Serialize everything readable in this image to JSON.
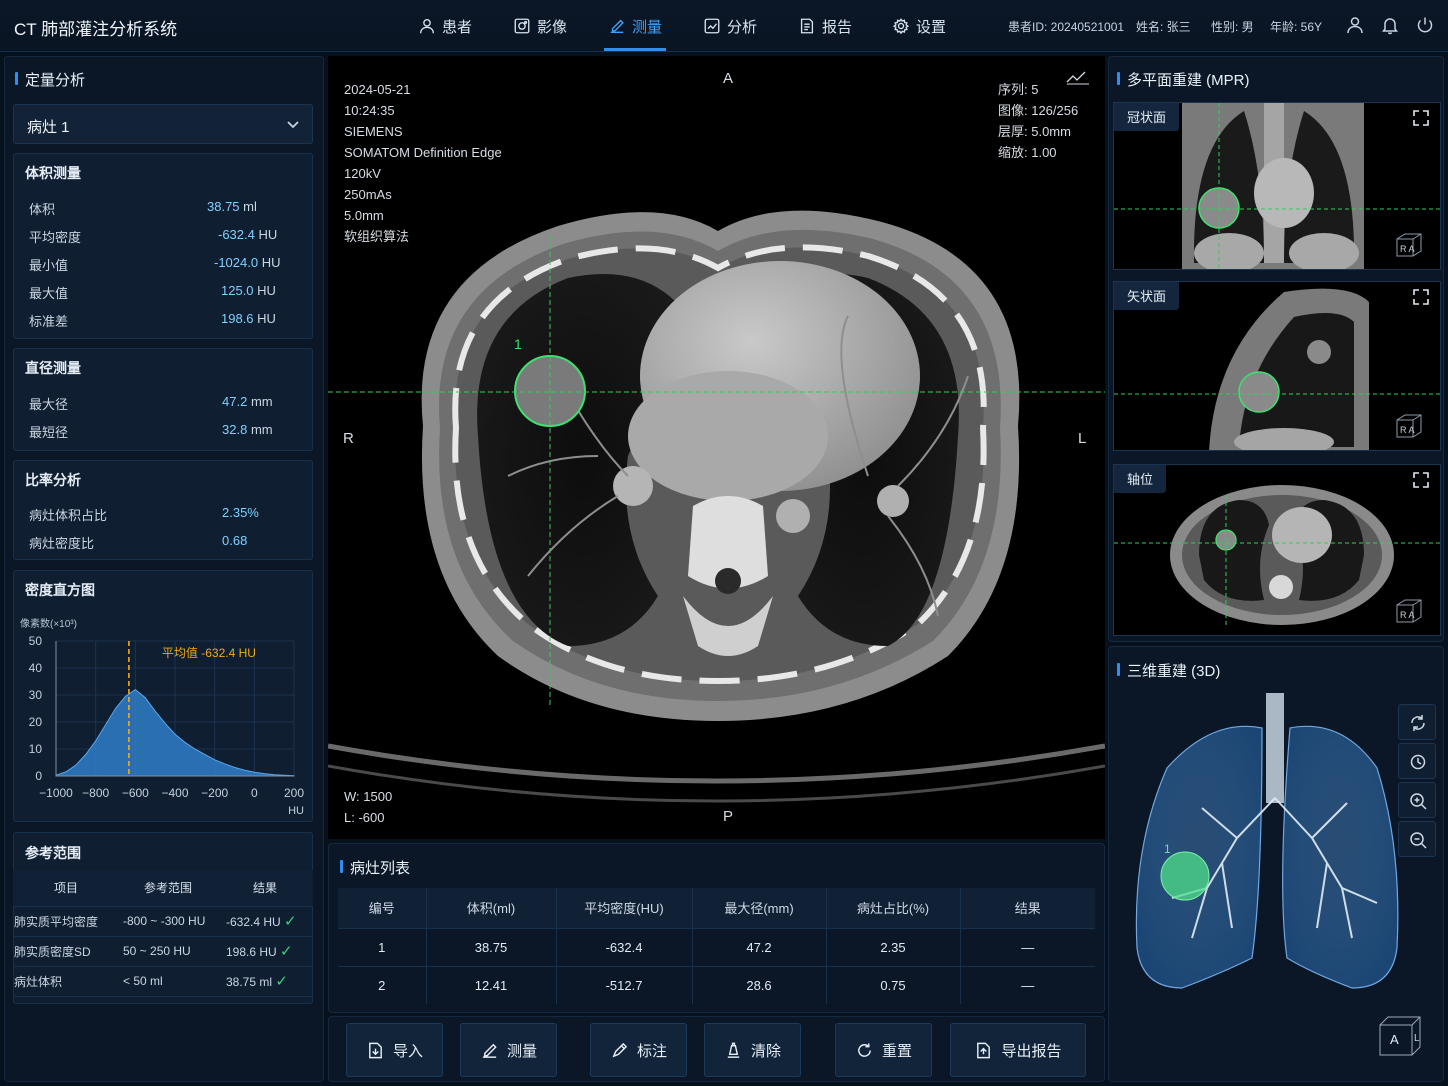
{
  "app": {
    "title": "CT 肺部灌注分析系统"
  },
  "nav": [
    {
      "label": "患者",
      "icon": "user-icon"
    },
    {
      "label": "影像",
      "icon": "image-icon"
    },
    {
      "label": "测量",
      "icon": "edit-icon",
      "active": true
    },
    {
      "label": "分析",
      "icon": "chart-icon"
    },
    {
      "label": "报告",
      "icon": "report-icon"
    },
    {
      "label": "设置",
      "icon": "gear-icon"
    }
  ],
  "patient": {
    "id": "患者ID: 20240521001",
    "name": "姓名: 张三",
    "sex": "性别: 男",
    "age": "年龄: 56Y"
  },
  "left": {
    "title": "定量分析",
    "lesion_select": "病灶 1",
    "volume": {
      "title": "体积测量",
      "rows": [
        {
          "k": "体积",
          "v": "38.75",
          "u": "ml"
        },
        {
          "k": "平均密度",
          "v": "-632.4",
          "u": "HU"
        },
        {
          "k": "最小值",
          "v": "-1024.0",
          "u": "HU"
        },
        {
          "k": "最大值",
          "v": "125.0",
          "u": "HU"
        },
        {
          "k": "标准差",
          "v": "198.6",
          "u": "HU"
        }
      ]
    },
    "diameter": {
      "title": "直径测量",
      "rows": [
        {
          "k": "最大径",
          "v": "47.2",
          "u": "mm"
        },
        {
          "k": "最短径",
          "v": "32.8",
          "u": "mm"
        }
      ]
    },
    "ratio": {
      "title": "比率分析",
      "rows": [
        {
          "k": "病灶体积占比",
          "v": "2.35%",
          "u": ""
        },
        {
          "k": "病灶密度比",
          "v": "0.68",
          "u": ""
        }
      ]
    },
    "histogram": {
      "title": "密度直方图",
      "ylabel": "像素数(×10³)",
      "xunit": "HU",
      "mean_label": "平均值 -632.4 HU"
    },
    "reference": {
      "title": "参考范围",
      "headers": [
        "项目",
        "参考范围",
        "结果"
      ],
      "rows": [
        {
          "item": "肺实质平均密度",
          "range": "-800 ~ -300 HU",
          "result": "-632.4 HU",
          "ok": "✓"
        },
        {
          "item": "肺实质密度SD",
          "range": "50 ~ 250 HU",
          "result": "198.6 HU",
          "ok": "✓"
        },
        {
          "item": "病灶体积",
          "range": "< 50 ml",
          "result": "38.75 ml",
          "ok": "✓"
        }
      ]
    }
  },
  "chart_data": {
    "type": "area",
    "ylabel": "像素数(×10³)",
    "xlabel": "HU",
    "xlim": [
      -1000,
      200
    ],
    "ylim": [
      0,
      50
    ],
    "x_ticks": [
      "-1000",
      "-800",
      "-600",
      "-400",
      "-200",
      "0",
      "200"
    ],
    "y_ticks": [
      "0",
      "10",
      "20",
      "30",
      "40",
      "50"
    ],
    "x": [
      -1000,
      -950,
      -900,
      -850,
      -800,
      -750,
      -700,
      -650,
      -600,
      -550,
      -500,
      -450,
      -400,
      -350,
      -300,
      -250,
      -200,
      -150,
      -100,
      -50,
      0,
      50,
      100,
      150,
      200
    ],
    "values": [
      0.3,
      1.5,
      4,
      8,
      13,
      19,
      25,
      29.5,
      32,
      29,
      24,
      19.5,
      15.5,
      12.5,
      10,
      8,
      6,
      4.5,
      3.2,
      2.2,
      1.4,
      0.9,
      0.5,
      0.3,
      0.1
    ],
    "mean_marker": {
      "x": -632.4,
      "label": "平均值 -632.4 HU"
    },
    "grid": true
  },
  "viewer": {
    "info_left": [
      "2024-05-21",
      "10:24:35",
      "SIEMENS",
      "SOMATOM Definition Edge",
      "120kV",
      "250mAs",
      "5.0mm",
      "软组织算法"
    ],
    "info_right": [
      "序列: 5",
      "图像: 126/256",
      "层厚: 5.0mm",
      "缩放: 1.00"
    ],
    "orient": {
      "top": "A",
      "bottom": "P",
      "left": "R",
      "right": "L"
    },
    "window": [
      "W: 1500",
      "L: -600"
    ],
    "lesion_marker": "1"
  },
  "lesion_list": {
    "title": "病灶列表",
    "headers": [
      "编号",
      "体积(ml)",
      "平均密度(HU)",
      "最大径(mm)",
      "病灶占比(%)",
      "结果"
    ],
    "rows": [
      [
        "1",
        "38.75",
        "-632.4",
        "47.2",
        "2.35",
        "—"
      ],
      [
        "2",
        "12.41",
        "-512.7",
        "28.6",
        "0.75",
        "—"
      ]
    ]
  },
  "toolbar": [
    {
      "label": "导入",
      "icon": "import-icon"
    },
    {
      "label": "测量",
      "icon": "measure-icon"
    },
    {
      "label": "标注",
      "icon": "annotate-icon"
    },
    {
      "label": "清除",
      "icon": "clear-icon"
    },
    {
      "label": "重置",
      "icon": "reset-icon"
    },
    {
      "label": "导出报告",
      "icon": "export-icon"
    }
  ],
  "mpr": {
    "title": "多平面重建 (MPR)",
    "views": [
      {
        "label": "冠状面",
        "cube": "R A"
      },
      {
        "label": "矢状面",
        "cube": "R A"
      },
      {
        "label": "轴位",
        "cube": "R A"
      }
    ]
  },
  "recon3d": {
    "title": "三维重建 (3D)",
    "cube_a": "A",
    "cube_l": "L",
    "marker": "1"
  }
}
